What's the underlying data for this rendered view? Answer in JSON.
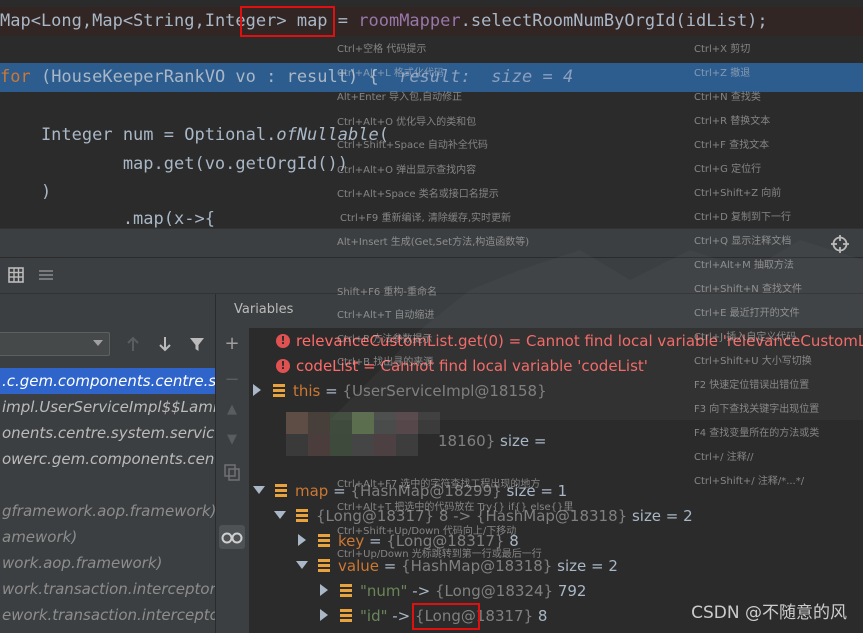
{
  "editor": {
    "line1": {
      "t1": "Map<Long,Map<String,",
      "t2": "Integer",
      "t3": "> map = ",
      "t4": "roomMapper",
      "t5": ".selectRoomNumByOrgId(idList);"
    },
    "line2": {
      "kw": "for",
      "t1": " (HouseKeeperRankVO vo : result) {",
      "hint": "  result:  size = 4"
    },
    "line3": {
      "t1": "    Integer num = Optional.",
      "t2": "ofNullable",
      "t3": "("
    },
    "line4": {
      "t1": "            map.get(vo.getOrgId())"
    },
    "line5": {
      "t1": "    )"
    },
    "line6": {
      "t1": "            .map(x->{"
    }
  },
  "debug_panel": {
    "variables_title": "Variables"
  },
  "frames": [
    {
      "text": ".c.gem.components.centre.sys",
      "selected": true
    },
    {
      "text": "impl.UserServiceImpl$$Lamb",
      "selected": false,
      "dim": false
    },
    {
      "text": "onents.centre.system.service.i",
      "selected": false
    },
    {
      "text": "owerc.gem.components.centr",
      "selected": false
    },
    {
      "text": "",
      "selected": false
    },
    {
      "text": "gframework.aop.framework)",
      "selected": false
    },
    {
      "text": "amework)",
      "selected": false
    },
    {
      "text": "work.aop.framework)",
      "selected": false
    },
    {
      "text": "work.transaction.interceptor)",
      "selected": false
    },
    {
      "text": "ework.transaction.interceptor",
      "selected": false
    }
  ],
  "variables": {
    "err1": {
      "name": "relevanceCustomList.get(0)",
      "msg": " = Cannot find local variable 'relevanceCustomList'"
    },
    "err2": {
      "name": "codeList",
      "msg": " = Cannot find local variable 'codeList'"
    },
    "this_row": {
      "name": "this",
      "eq": " = ",
      "ref": "{UserServiceImpl@18158}"
    },
    "blurred_row": {
      "ref": "18160}",
      "size": " size = "
    },
    "map_row": {
      "name": "map",
      "eq": " = ",
      "ref": "{HashMap@18299}",
      "size": " size = 1"
    },
    "entry_row": {
      "ref": "{Long@18317} 8 -> {HashMap@18318}",
      "size": " size = 2"
    },
    "key_row": {
      "name": "key",
      "eq": " = ",
      "ref": "{Long@18317}",
      "val": " 8"
    },
    "value_row": {
      "name": "value",
      "eq": " = ",
      "ref": "{HashMap@18318}",
      "size": " size = 2"
    },
    "num_row": {
      "key": "\"num\"",
      "arrow": " -> ",
      "ref": "{Long@18324}",
      "val": " 792"
    },
    "id_row": {
      "key": "\"id\"",
      "arrow": " -> ",
      "ref": "{Long@18317}",
      "val": " 8"
    }
  },
  "overlay_hints": {
    "left": [
      "Ctrl+空格  代码提示",
      "Ctrl+Alt+L  格式化代码",
      "Alt+Enter 导入包,自动修正",
      "Ctrl+Alt+O  优化导入的类和包",
      "Ctrl+Shift+Space 自动补全代码",
      "Ctrl+Alt+O  弹出显示查找内容",
      "Ctrl+Alt+Space  类名或接口名提示",
      "Ctrl+F9 重新编译, 清除缓存,实时更新",
      "Alt+Insert  生成(Get,Set方法,构造函数等)",
      "Shift+F6  重构-重命名",
      "Ctrl+Alt+T  自动缩进",
      "Ctrl+P  方法参数提示",
      "Ctrl+B  找出寻的来源",
      "Ctrl+Alt+F7  选中的字符查找工程出现的地方",
      "Ctrl+Alt+T  把选中的代码放在 Try{} if{} else{}里",
      "Ctrl+Shift+Up/Down 代码向上/下移动",
      "Ctrl+Up/Down 光标跳转到第一行或最后一行"
    ],
    "right": [
      "Ctrl+X  剪切",
      "Ctrl+Z  撤退",
      "Ctrl+N  查找类",
      "Ctrl+R 替换文本",
      "Ctrl+F  查找文本",
      "Ctrl+G  定位行",
      "Ctrl+Shift+Z  向前",
      "Ctrl+D  复制到下一行",
      "Ctrl+Q  显示注释文档",
      "Ctrl+Alt+M  抽取方法",
      "Ctrl+Shift+N 查找文件",
      "Ctrl+E 最近打开的文件",
      "Ctrl+J  插入自定义代码",
      "Ctrl+Shift+U 大小写切换",
      "F2 快速定位错误出错位置",
      "F3  向下查找关键字出现位置",
      "F4  查找变量所在的方法或类",
      "Ctrl+/  注释//",
      "Ctrl+Shift+/ 注释/*...*/"
    ]
  },
  "watermark": "CSDN @不随意的风",
  "colors": {
    "error": "#ff6b68",
    "selection": "#2d5c8e",
    "frame_selected": "#2f65ca",
    "annotation_box": "#e01010"
  }
}
